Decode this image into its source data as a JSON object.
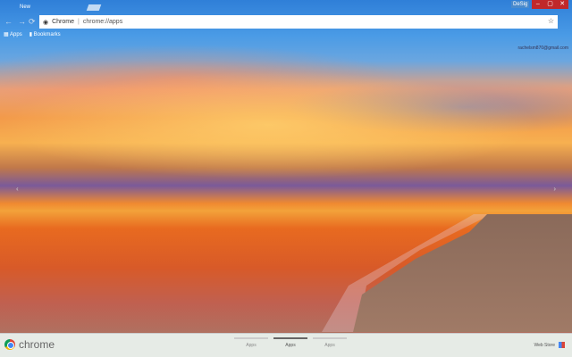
{
  "tab": {
    "title": "New"
  },
  "window": {
    "user": "DeSig",
    "controls": [
      "–",
      "▢",
      "✕"
    ]
  },
  "toolbar": {
    "back": "←",
    "forward": "→",
    "reload": "⟳",
    "chip": "Chrome",
    "separator": "|",
    "url": "chrome://apps",
    "star": "☆"
  },
  "bookmarks": [
    {
      "label": "Apps"
    },
    {
      "label": "Bookmarks"
    }
  ],
  "account": {
    "email": "rachelsm870@gmail.com"
  },
  "carousel": {
    "prev": "‹",
    "next": "›"
  },
  "footer": {
    "logo_text": "chrome",
    "pages": [
      {
        "label": "Apps"
      },
      {
        "label": "Apps",
        "active": true
      },
      {
        "label": "Apps"
      }
    ],
    "webstore": "Web Store"
  }
}
